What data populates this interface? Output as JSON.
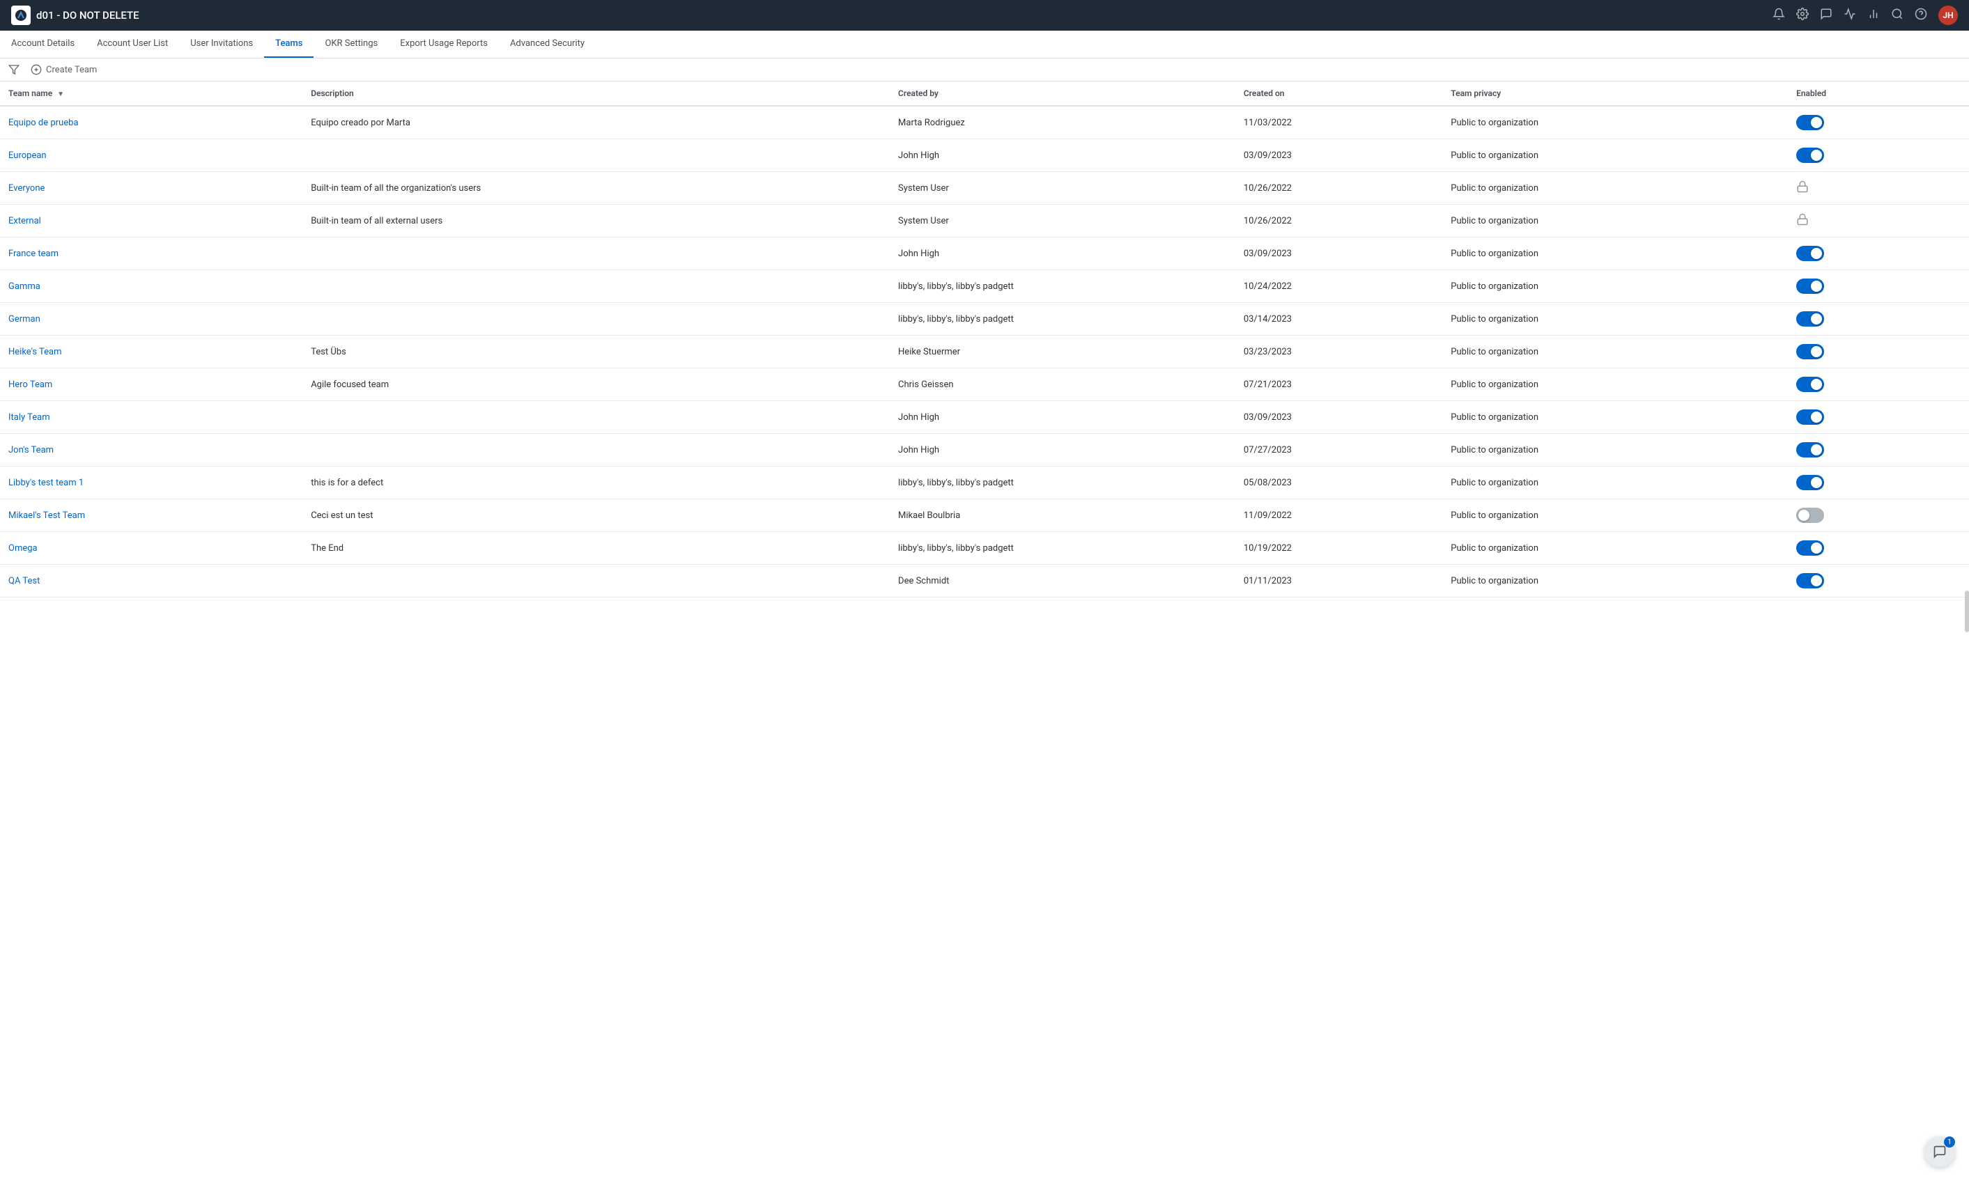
{
  "topbar": {
    "logo_alt": "Planview AgilePlace",
    "title": "d01 - DO NOT DELETE",
    "avatar_initials": "JH",
    "icons": [
      "notification-icon",
      "settings-icon",
      "messages-icon",
      "analytics-icon",
      "chart-icon",
      "search-icon",
      "help-icon"
    ]
  },
  "subnav": {
    "items": [
      {
        "label": "Account Details",
        "active": false
      },
      {
        "label": "Account User List",
        "active": false
      },
      {
        "label": "User Invitations",
        "active": false
      },
      {
        "label": "Teams",
        "active": true
      },
      {
        "label": "OKR Settings",
        "active": false
      },
      {
        "label": "Export Usage Reports",
        "active": false
      },
      {
        "label": "Advanced Security",
        "active": false
      }
    ]
  },
  "toolbar": {
    "filter_label": "Filter",
    "create_team_label": "Create Team"
  },
  "table": {
    "columns": [
      {
        "key": "team_name",
        "label": "Team name",
        "sortable": true
      },
      {
        "key": "description",
        "label": "Description",
        "sortable": false
      },
      {
        "key": "created_by",
        "label": "Created by",
        "sortable": false
      },
      {
        "key": "created_on",
        "label": "Created on",
        "sortable": false
      },
      {
        "key": "team_privacy",
        "label": "Team privacy",
        "sortable": false
      },
      {
        "key": "enabled",
        "label": "Enabled",
        "sortable": false
      }
    ],
    "rows": [
      {
        "team_name": "Equipo de prueba",
        "description": "Equipo creado por Marta",
        "created_by": "Marta Rodriguez",
        "created_on": "11/03/2022",
        "team_privacy": "Public to organization",
        "enabled": "on"
      },
      {
        "team_name": "European",
        "description": "",
        "created_by": "John High",
        "created_on": "03/09/2023",
        "team_privacy": "Public to organization",
        "enabled": "on"
      },
      {
        "team_name": "Everyone",
        "description": "Built-in team of all the organization's users",
        "created_by": "System User",
        "created_on": "10/26/2022",
        "team_privacy": "Public to organization",
        "enabled": "locked"
      },
      {
        "team_name": "External",
        "description": "Built-in team of all external users",
        "created_by": "System User",
        "created_on": "10/26/2022",
        "team_privacy": "Public to organization",
        "enabled": "locked"
      },
      {
        "team_name": "France team",
        "description": "",
        "created_by": "John High",
        "created_on": "03/09/2023",
        "team_privacy": "Public to organization",
        "enabled": "on"
      },
      {
        "team_name": "Gamma",
        "description": "",
        "created_by": "libby's, libby's, libby's padgett",
        "created_on": "10/24/2022",
        "team_privacy": "Public to organization",
        "enabled": "on"
      },
      {
        "team_name": "German",
        "description": "",
        "created_by": "libby's, libby's, libby's padgett",
        "created_on": "03/14/2023",
        "team_privacy": "Public to organization",
        "enabled": "on"
      },
      {
        "team_name": "Heike's Team",
        "description": "Test Übs",
        "created_by": "Heike Stuermer",
        "created_on": "03/23/2023",
        "team_privacy": "Public to organization",
        "enabled": "on"
      },
      {
        "team_name": "Hero Team",
        "description": "Agile focused team",
        "created_by": "Chris Geissen",
        "created_on": "07/21/2023",
        "team_privacy": "Public to organization",
        "enabled": "on"
      },
      {
        "team_name": "Italy Team",
        "description": "",
        "created_by": "John High",
        "created_on": "03/09/2023",
        "team_privacy": "Public to organization",
        "enabled": "on"
      },
      {
        "team_name": "Jon's Team",
        "description": "",
        "created_by": "John High",
        "created_on": "07/27/2023",
        "team_privacy": "Public to organization",
        "enabled": "on"
      },
      {
        "team_name": "Libby's test team 1",
        "description": "this is for a defect",
        "created_by": "libby's, libby's, libby's padgett",
        "created_on": "05/08/2023",
        "team_privacy": "Public to organization",
        "enabled": "on"
      },
      {
        "team_name": "Mikael's Test Team",
        "description": "Ceci est un test",
        "created_by": "Mikael Boulbria",
        "created_on": "11/09/2022",
        "team_privacy": "Public to organization",
        "enabled": "off"
      },
      {
        "team_name": "Omega",
        "description": "The End",
        "created_by": "libby's, libby's, libby's padgett",
        "created_on": "10/19/2022",
        "team_privacy": "Public to organization",
        "enabled": "on"
      },
      {
        "team_name": "QA Test",
        "description": "",
        "created_by": "Dee Schmidt",
        "created_on": "01/11/2023",
        "team_privacy": "Public to organization",
        "enabled": "on"
      }
    ]
  },
  "chat": {
    "badge_count": "1"
  }
}
